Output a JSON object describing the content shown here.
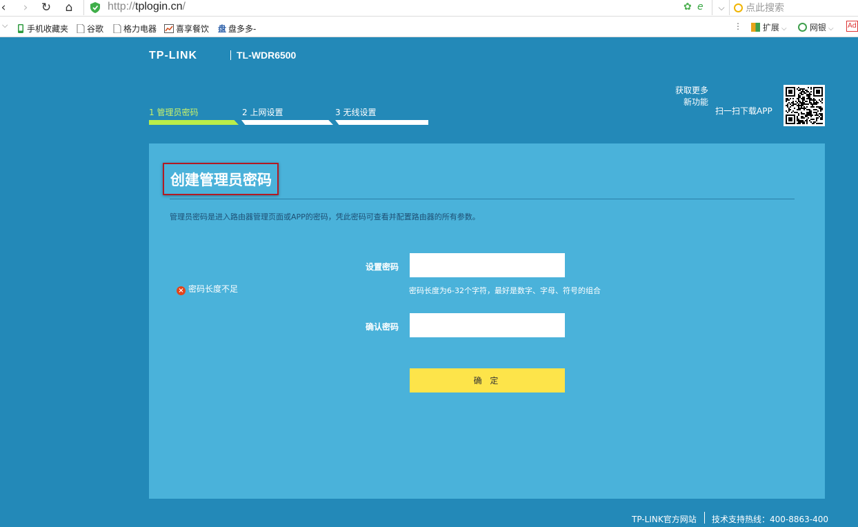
{
  "browser": {
    "url_protocol": "http://",
    "url_host": "tplogin.cn",
    "url_suffix": "/",
    "search_placeholder": "点此搜索",
    "bookmarks": [
      "手机收藏夹",
      "谷歌",
      "格力电器",
      "喜享餐饮",
      "盘多多-"
    ],
    "extensions_label": "扩展",
    "netbank_label": "网银",
    "icons": [
      "back-icon",
      "forward-icon",
      "refresh-icon",
      "home-icon",
      "shield-icon",
      "compat-mode-icon",
      "ie-icon",
      "dropdown-icon",
      "search-icon",
      "more-icon",
      "extensions-icon",
      "netbank-icon",
      "adblock-icon"
    ],
    "adblock_label": "Ad"
  },
  "router": {
    "brand": "TP-LINK",
    "model": "TL-WDR6500",
    "more_features_line1": "获取更多",
    "more_features_line2": "新功能",
    "scan_download": "扫一扫下载APP",
    "steps": [
      {
        "label": "1 管理员密码",
        "active": true
      },
      {
        "label": "2 上网设置",
        "active": false
      },
      {
        "label": "3 无线设置",
        "active": false
      }
    ],
    "page_title": "创建管理员密码",
    "description": "管理员密码是进入路由器管理页面或APP的密码，凭此密码可查看并配置路由器的所有参数。",
    "error_message": "密码长度不足",
    "set_password_label": "设置密码",
    "set_password_value": "",
    "password_hint": "密码长度为6-32个字符，最好是数字、字母、符号的组合",
    "confirm_password_label": "确认密码",
    "confirm_password_value": "",
    "confirm_button": "确 定",
    "footer_site": "TP-LINK官方网站",
    "footer_hotline": "技术支持热线：400-8863-400",
    "colors": {
      "background": "#2389b8",
      "panel": "#4ab2da",
      "active_step": "#b9ee4a",
      "button": "#fde44a",
      "title_border": "#b21a23",
      "error_icon": "#e2451b"
    }
  }
}
